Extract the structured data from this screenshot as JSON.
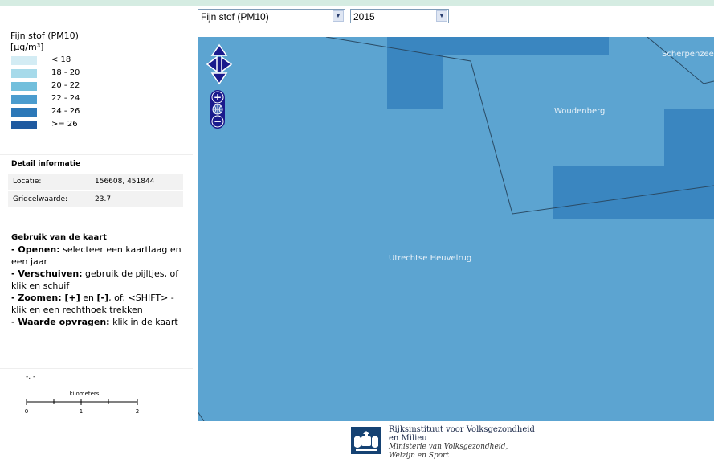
{
  "colors": {
    "topbar": "#d5ece2",
    "map_base": "#5ca4d1",
    "map_dark": "#3a86c0",
    "legend": [
      "#d3ecf4",
      "#a6daea",
      "#72bfdc",
      "#4b9cce",
      "#2c78b8",
      "#1f5aa0"
    ],
    "nav_control": "#1a1a8c"
  },
  "selectors": {
    "layer": "Fijn stof (PM10)",
    "year": "2015"
  },
  "legend": {
    "title_line1": "Fijn stof (PM10)",
    "title_line2": "[µg/m³]",
    "items": [
      {
        "label": "< 18"
      },
      {
        "label": "18 - 20"
      },
      {
        "label": "20 - 22"
      },
      {
        "label": "22 - 24"
      },
      {
        "label": "24 - 26"
      },
      {
        "label": ">= 26"
      }
    ]
  },
  "detail": {
    "heading": "Detail informatie",
    "location_label": "Locatie:",
    "location_value": "156608, 451844",
    "grid_label": "Gridcelwaarde:",
    "grid_value": "23.7"
  },
  "usage": {
    "heading": "Gebruik van de kaart",
    "open_key": "- Openen:",
    "open_text": " selecteer een kaartlaag en een jaar",
    "move_key": "- Verschuiven:",
    "move_text": " gebruik de pijltjes, of klik en schuif",
    "zoom_key": "- Zoomen: [+]",
    "zoom_en": " en ",
    "zoom_key2": "[-]",
    "zoom_text": ", of: <SHIFT> -klik en een rechthoek trekken",
    "value_key": "- Waarde opvragen:",
    "value_text": " klik in de kaart"
  },
  "coords_readout": "-, -",
  "scale": {
    "unit": "kilometers",
    "ticks": [
      "0",
      "1",
      "2"
    ]
  },
  "map": {
    "places": [
      "Scherpenzeel",
      "Woudenberg",
      "Utrechtse Heuvelrug"
    ],
    "zoom_in": "+",
    "zoom_out": "−"
  },
  "footer": {
    "line1": "Rijksinstituut voor Volksgezondheid",
    "line2": "en Milieu",
    "line3": "Ministerie van Volksgezondheid,",
    "line4": "Welzijn en Sport"
  }
}
